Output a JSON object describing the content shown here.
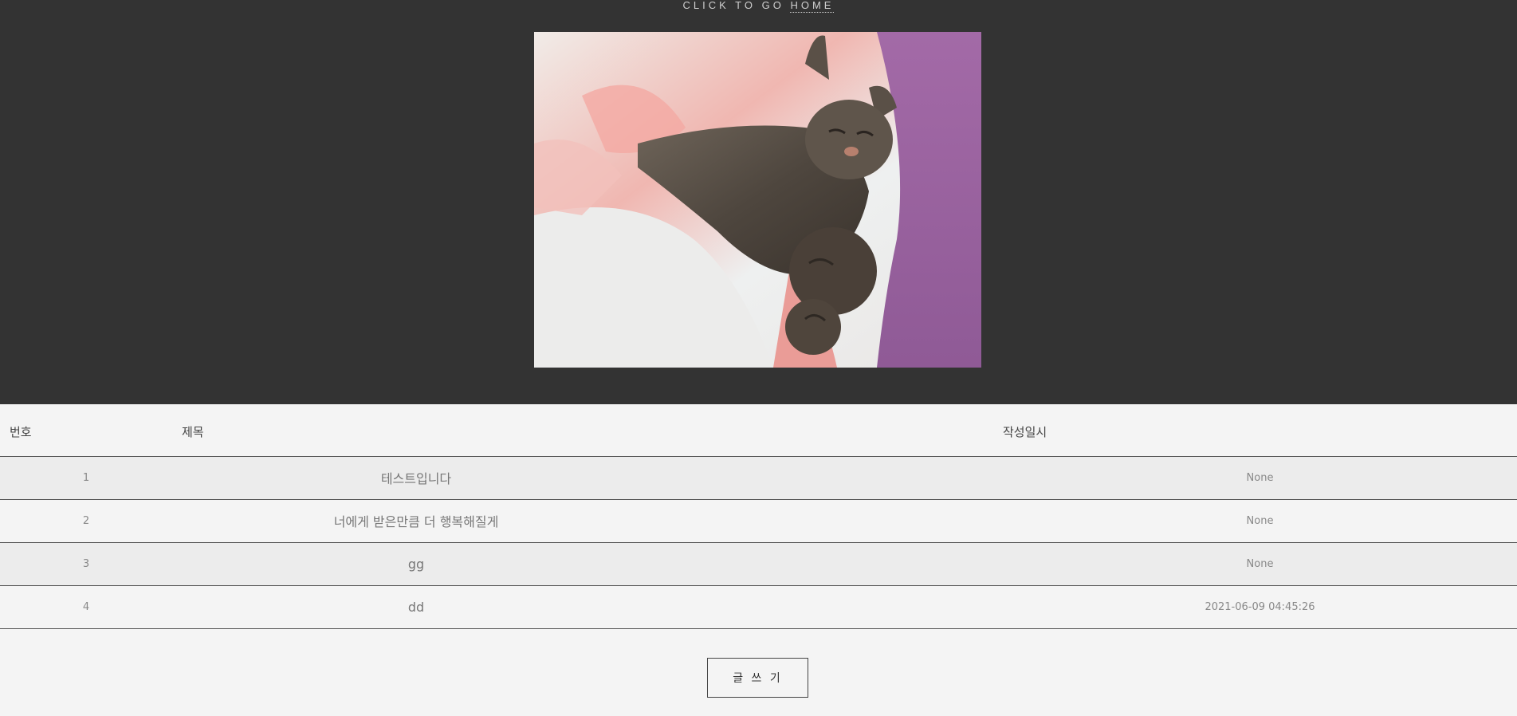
{
  "header": {
    "home_prefix": "CLICK TO GO",
    "home_label": "HOME"
  },
  "photo": {
    "alt": "sleeping tabby cat on pink and white blanket"
  },
  "board": {
    "columns": [
      "번호",
      "제목",
      "작성일시"
    ],
    "rows": [
      {
        "no": "1",
        "title": "테스트입니다",
        "date": "None"
      },
      {
        "no": "2",
        "title": "너에게 받은만큼 더 행복해질게",
        "date": "None"
      },
      {
        "no": "3",
        "title": "gg",
        "date": "None"
      },
      {
        "no": "4",
        "title": "dd",
        "date": "2021-06-09 04:45:26"
      }
    ],
    "write_label": "글 쓰 기"
  },
  "colors": {
    "header_bg": "#333333",
    "body_bg": "#f4f4f4",
    "row_alt_bg": "#ececec"
  }
}
